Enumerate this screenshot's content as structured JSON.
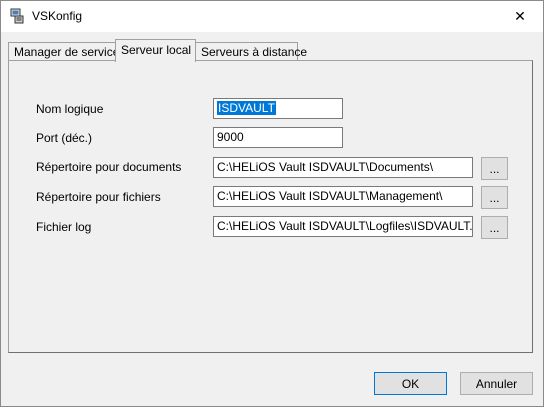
{
  "window": {
    "title": "VSKonfig",
    "close_glyph": "✕",
    "app_icon": "computer-icon"
  },
  "tabs": [
    {
      "label": "Manager de service"
    },
    {
      "label": "Serveur local"
    },
    {
      "label": "Serveurs à distance"
    }
  ],
  "form": {
    "nom_logique": {
      "label": "Nom logique",
      "value": "ISDVAULT"
    },
    "port": {
      "label": "Port (déc.)",
      "value": "9000"
    },
    "rep_documents": {
      "label": "Répertoire pour documents",
      "value": "C:\\HELiOS Vault ISDVAULT\\Documents\\"
    },
    "rep_fichiers": {
      "label": "Répertoire pour fichiers",
      "value": "C:\\HELiOS Vault ISDVAULT\\Management\\"
    },
    "fichier_log": {
      "label": "Fichier log",
      "value": "C:\\HELiOS Vault ISDVAULT\\Logfiles\\ISDVAULT.log"
    },
    "browse_label": "..."
  },
  "buttons": {
    "ok": "OK",
    "cancel": "Annuler"
  }
}
